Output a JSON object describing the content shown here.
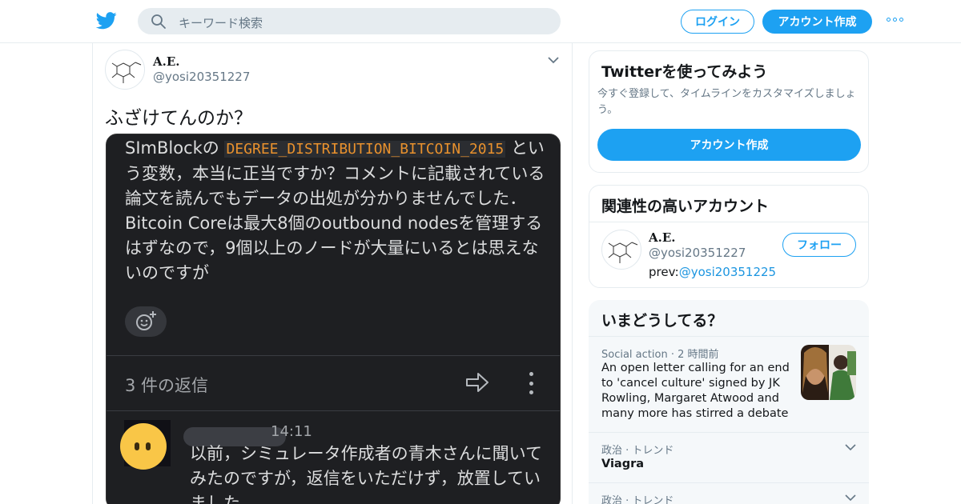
{
  "topbar": {
    "search_placeholder": "キーワード検索",
    "login_label": "ログイン",
    "signup_label": "アカウント作成",
    "brand_color": "#1da1f2"
  },
  "tweet": {
    "author_name": "A.E.",
    "author_handle": "@yosi20351227",
    "text": "ふざけてんのか？",
    "media": {
      "message_prefix": "SImBlockの",
      "message_code": "DEGREE_DISTRIBUTION_BITCOIN_2015",
      "message_suffix": "という変数，本当に正当ですか？コメントに記載されている論文を読んでもデータの出処が分かりませんでした．Bitcoin Coreは最大8個のoutbound nodesを管理するはずなので，9個以上のノードが大量にいるとは思えないのですが",
      "replies_label": "3 件の返信",
      "reply_time": "14:11",
      "reply_text": "以前，シミュレータ作成者の青木さんに聞いてみたのですが，返信をいただけず，放置していました．"
    }
  },
  "sidebar": {
    "signup_card": {
      "heading": "Twitterを使ってみよう",
      "body": "今すぐ登録して、タイムラインをカスタマイズしましょう。",
      "cta": "アカウント作成"
    },
    "related": {
      "heading": "関連性の高いアカウント",
      "account_name": "A.E.",
      "account_handle": "@yosi20351227",
      "prev_label": "prev:",
      "prev_handle": "@yosi20351225",
      "follow_label": "フォロー"
    },
    "trends": {
      "heading": "いまどうしてる？",
      "story": {
        "category": "Social action",
        "time": "2 時間前",
        "title": "An open letter calling for an end to 'cancel culture' signed by JK Rowling, Margaret Atwood and many more has stirred a debate"
      },
      "items": [
        {
          "category": "政治 · トレンド",
          "title": "Viagra"
        },
        {
          "category": "政治 · トレンド",
          "title": ""
        }
      ]
    }
  }
}
